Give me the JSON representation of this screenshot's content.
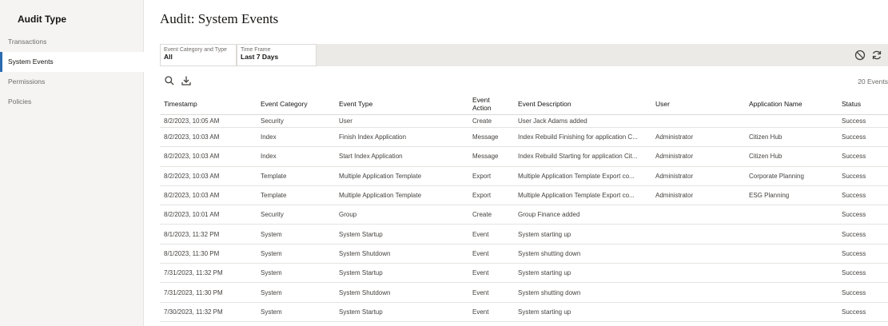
{
  "sidebar": {
    "title": "Audit Type",
    "items": [
      {
        "label": "Transactions"
      },
      {
        "label": "System Events"
      },
      {
        "label": "Permissions"
      },
      {
        "label": "Policies"
      }
    ],
    "active_item": "System Events"
  },
  "header": {
    "title": "Audit: System Events"
  },
  "filters": [
    {
      "label": "Event Category and Type",
      "value": "All"
    },
    {
      "label": "Time Frame",
      "value": "Last 7 Days"
    }
  ],
  "filter_icons": [
    "clear-filters-icon",
    "refresh-icon"
  ],
  "toolbar": {
    "icons": [
      "search-icon",
      "export-icon"
    ],
    "event_count": "20 Events"
  },
  "table": {
    "columns": [
      "Timestamp",
      "Event Category",
      "Event Type",
      "Event Action",
      "Event Description",
      "User",
      "Application Name",
      "Status"
    ],
    "rows": [
      {
        "timestamp": "8/2/2023, 10:05 AM",
        "category": "Security",
        "type": "User",
        "action": "Create",
        "description": "User Jack Adams added",
        "user": "",
        "application": "",
        "status": "Success"
      },
      {
        "timestamp": "8/2/2023, 10:03 AM",
        "category": "Index",
        "type": "Finish Index Application",
        "action": "Message",
        "description": "Index Rebuild Finishing for application C...",
        "user": "Administrator",
        "application": "Citizen Hub",
        "status": "Success"
      },
      {
        "timestamp": "8/2/2023, 10:03 AM",
        "category": "Index",
        "type": "Start Index Application",
        "action": "Message",
        "description": "Index Rebuild Starting for application Cit...",
        "user": "Administrator",
        "application": "Citizen Hub",
        "status": "Success"
      },
      {
        "timestamp": "8/2/2023, 10:03 AM",
        "category": "Template",
        "type": "Multiple Application Template",
        "action": "Export",
        "description": "Multiple Application Template Export co...",
        "user": "Administrator",
        "application": "Corporate Planning",
        "status": "Success"
      },
      {
        "timestamp": "8/2/2023, 10:03 AM",
        "category": "Template",
        "type": "Multiple Application Template",
        "action": "Export",
        "description": "Multiple Application Template Export co...",
        "user": "Administrator",
        "application": "ESG Planning",
        "status": "Success"
      },
      {
        "timestamp": "8/2/2023, 10:01 AM",
        "category": "Security",
        "type": "Group",
        "action": "Create",
        "description": "Group Finance added",
        "user": "",
        "application": "",
        "status": "Success"
      },
      {
        "timestamp": "8/1/2023, 11:32 PM",
        "category": "System",
        "type": "System Startup",
        "action": "Event",
        "description": "System starting up",
        "user": "",
        "application": "",
        "status": "Success"
      },
      {
        "timestamp": "8/1/2023, 11:30 PM",
        "category": "System",
        "type": "System Shutdown",
        "action": "Event",
        "description": "System shutting down",
        "user": "",
        "application": "",
        "status": "Success"
      },
      {
        "timestamp": "7/31/2023, 11:32 PM",
        "category": "System",
        "type": "System Startup",
        "action": "Event",
        "description": "System starting up",
        "user": "",
        "application": "",
        "status": "Success"
      },
      {
        "timestamp": "7/31/2023, 11:30 PM",
        "category": "System",
        "type": "System Shutdown",
        "action": "Event",
        "description": "System shutting down",
        "user": "",
        "application": "",
        "status": "Success"
      },
      {
        "timestamp": "7/30/2023, 11:32 PM",
        "category": "System",
        "type": "System Startup",
        "action": "Event",
        "description": "System starting up",
        "user": "",
        "application": "",
        "status": "Success"
      }
    ]
  },
  "colors": {
    "accent": "#2a6bb0",
    "sidebar_bg": "#f5f4f2",
    "filter_bar_bg": "#eceae7"
  }
}
